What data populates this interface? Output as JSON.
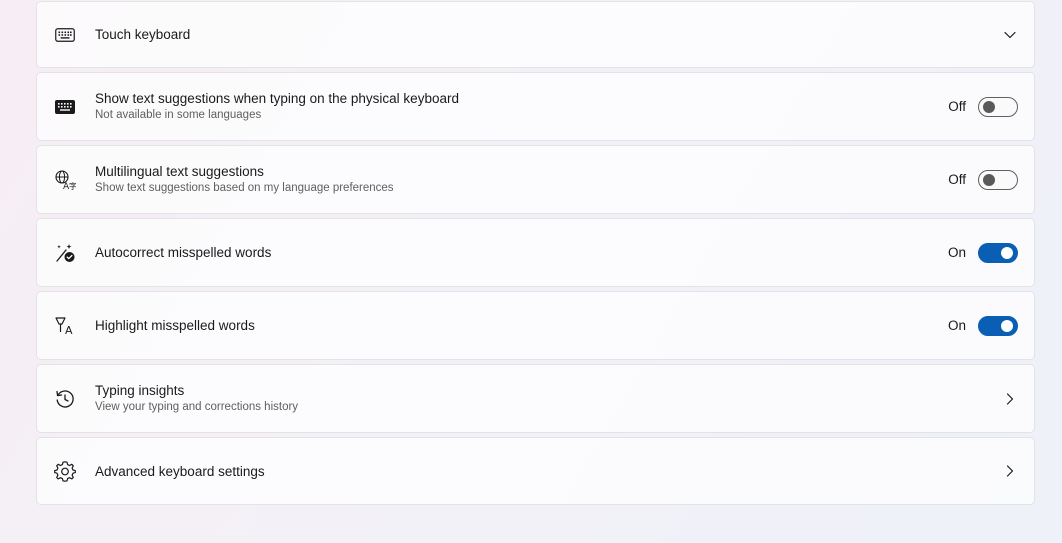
{
  "settings": {
    "touch_keyboard": {
      "title": "Touch keyboard",
      "icon": "keyboard-icon",
      "expanded": false
    },
    "text_suggestions": {
      "title": "Show text suggestions when typing on the physical keyboard",
      "subtitle": "Not available in some languages",
      "state_label": "Off",
      "icon": "keyboard-filled-icon",
      "on": false
    },
    "multilingual": {
      "title": "Multilingual text suggestions",
      "subtitle": "Show text suggestions based on my language preferences",
      "state_label": "Off",
      "icon": "language-icon",
      "on": false
    },
    "autocorrect": {
      "title": "Autocorrect misspelled words",
      "state_label": "On",
      "icon": "autocorrect-icon",
      "on": true
    },
    "highlight": {
      "title": "Highlight misspelled words",
      "state_label": "On",
      "icon": "highlight-text-icon",
      "on": true
    },
    "typing_insights": {
      "title": "Typing insights",
      "subtitle": "View your typing and corrections history",
      "icon": "history-icon"
    },
    "advanced_keyboard": {
      "title": "Advanced keyboard settings",
      "icon": "gear-icon"
    }
  },
  "colors": {
    "accent": "#0a5fb4",
    "card_background": "#ffffff",
    "border": "#e3e3e6"
  }
}
